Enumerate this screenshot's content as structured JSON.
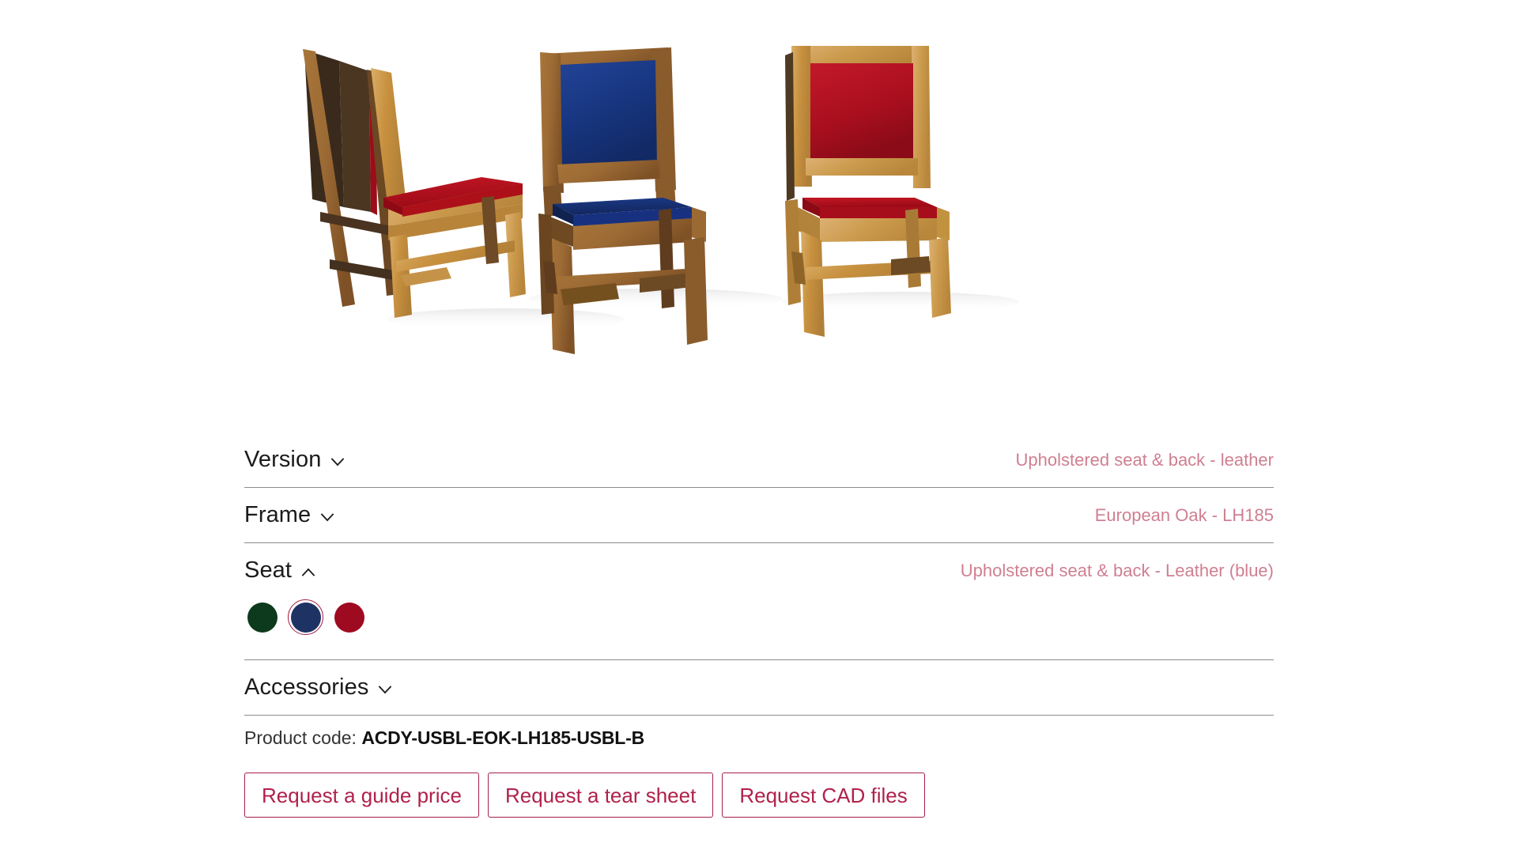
{
  "product": {
    "code_label": "Product code:",
    "code_value": "ACDY-USBL-EOK-LH185-USBL-B"
  },
  "gallery": {
    "alt": "Three oak chairs: rear view with red seat, front view with blue upholstery, front view with red upholstery",
    "background": "#ffffff",
    "chairs": [
      {
        "name": "chair-rear-red",
        "frame": "#c8913f",
        "upholstery": "#b3111f",
        "view": "rear-three-quarter"
      },
      {
        "name": "chair-front-blue",
        "frame": "#9c6a34",
        "upholstery": "#17357f",
        "view": "front-three-quarter"
      },
      {
        "name": "chair-front-red",
        "frame": "#d2a055",
        "upholstery": "#b0101f",
        "view": "front"
      }
    ]
  },
  "options": [
    {
      "id": "version",
      "label": "Version",
      "value": "Upholstered seat & back - leather",
      "expanded": false,
      "chevron": "chevron-down-icon"
    },
    {
      "id": "frame",
      "label": "Frame",
      "value": "European Oak - LH185",
      "expanded": false,
      "chevron": "chevron-down-icon"
    },
    {
      "id": "seat",
      "label": "Seat",
      "value": "Upholstered seat & back - Leather (blue)",
      "expanded": true,
      "chevron": "chevron-up-icon",
      "swatches": [
        {
          "name": "swatch-green",
          "color": "#0d3a1c",
          "selected": false
        },
        {
          "name": "swatch-blue",
          "color": "#1e3264",
          "selected": true
        },
        {
          "name": "swatch-red",
          "color": "#9e0a20",
          "selected": false
        }
      ]
    },
    {
      "id": "accessories",
      "label": "Accessories",
      "value": "",
      "expanded": false,
      "chevron": "chevron-down-icon"
    }
  ],
  "buttons": [
    {
      "id": "request-guide-price",
      "label": "Request a guide price"
    },
    {
      "id": "request-tear-sheet",
      "label": "Request a tear sheet"
    },
    {
      "id": "request-cad-files",
      "label": "Request CAD files"
    }
  ],
  "colors": {
    "accent": "#a6204a",
    "value_text": "#cf7f92",
    "label_text": "#1b1b1b",
    "divider": "#8c8c8c",
    "selected_ring": "#a6204a"
  }
}
